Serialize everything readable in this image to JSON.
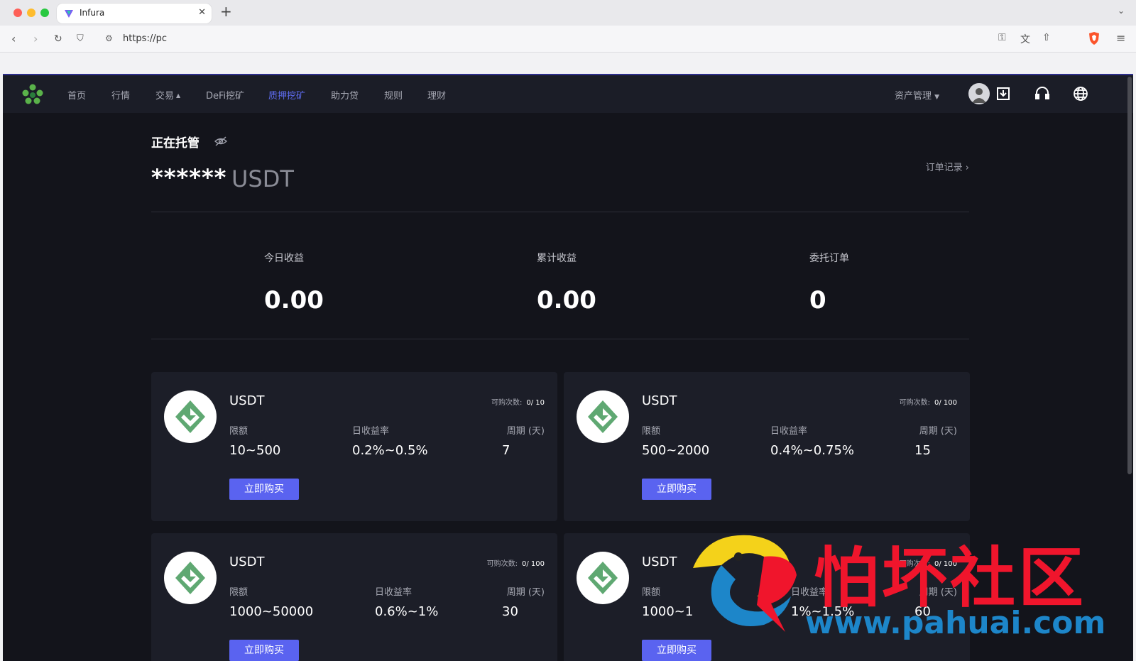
{
  "browser": {
    "tab_title": "Infura",
    "url": "https://pc"
  },
  "nav": {
    "items": [
      "首页",
      "行情",
      "交易",
      "DeFi挖矿",
      "质押挖矿",
      "助力贷",
      "规则",
      "理财"
    ],
    "active": "质押挖矿",
    "asset_menu": "资产管理",
    "accent_color": "#5f6df3"
  },
  "hosting": {
    "title": "正在托管",
    "balance_masked": "******",
    "unit": "USDT",
    "order_link": "订单记录"
  },
  "stats": [
    {
      "label": "今日收益",
      "value": "0.00"
    },
    {
      "label": "累计收益",
      "value": "0.00"
    },
    {
      "label": "委托订单",
      "value": "0"
    }
  ],
  "labels": {
    "quota": "可购次数:",
    "limit": "限额",
    "daily_rate": "日收益率",
    "period": "周期 (天)",
    "buy": "立即购买"
  },
  "products": [
    {
      "name": "USDT",
      "quota_used": "0/",
      "quota_total": "10",
      "limit": "10~500",
      "rate": "0.2%~0.5%",
      "period": "7"
    },
    {
      "name": "USDT",
      "quota_used": "0/",
      "quota_total": "100",
      "limit": "500~2000",
      "rate": "0.4%~0.75%",
      "period": "15"
    },
    {
      "name": "USDT",
      "quota_used": "0/",
      "quota_total": "100",
      "limit": "1000~50000",
      "rate": "0.6%~1%",
      "period": "30"
    },
    {
      "name": "USDT",
      "quota_used": "0/",
      "quota_total": "100",
      "limit": "1000~1",
      "rate": "1%~1.5%",
      "period": "60"
    }
  ],
  "watermark": {
    "cn": "怕坏社区",
    "url": "www.pahuai.com"
  }
}
